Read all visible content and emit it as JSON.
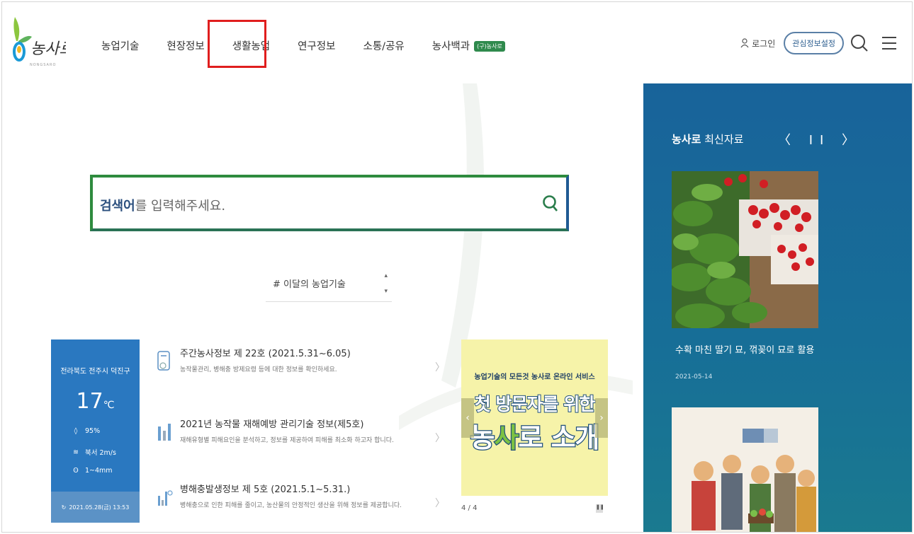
{
  "header": {
    "logo_text": "농사로",
    "nav": [
      {
        "label": "농업기술"
      },
      {
        "label": "현장정보"
      },
      {
        "label": "생활농업"
      },
      {
        "label": "연구정보"
      },
      {
        "label": "소통/공유"
      },
      {
        "label": "농사백과"
      }
    ],
    "nav_badge": "(구)농사로",
    "login_label": "로그인",
    "interest_label": "관심정보설정"
  },
  "search": {
    "placeholder_bold": "검색어",
    "placeholder_rest": "를 입력해주세요."
  },
  "topic": {
    "label": "# 이달의 농업기술"
  },
  "weather": {
    "location": "전라북도 전주시 덕진구",
    "temperature": "17",
    "unit": "℃",
    "humidity": "95%",
    "wind": "북서 2m/s",
    "rain": "1~4mm",
    "datetime": "2021.05.28(금) 13:53"
  },
  "news": [
    {
      "title": "주간농사정보 제 22호 (2021.5.31~6.05)",
      "desc": "농작물관리, 병해충 방제요령 등에 대한 정보를 확인하세요."
    },
    {
      "title": "2021년 농작물 재해예방 관리기술 정보(제5호)",
      "desc": "재해유형별 피해요인을 분석하고, 정보를 제공하여 피해를 최소화 하고자 합니다."
    },
    {
      "title": "병해충발생정보 제 5호 (2021.5.1~5.31.)",
      "desc": "병해충으로 인한 피해를 줄이고, 농산물의 안정적인 생산을 위해 정보를 제공합니다."
    }
  ],
  "banner": {
    "subtitle": "농업기술의 모든것 농사로 온라인 서비스",
    "line1": "첫 방문자를 위한",
    "line2_a": "농",
    "line2_b": "사",
    "line2_c": "로 소개",
    "pager": "4 / 4"
  },
  "side": {
    "title_bold": "농사로",
    "title_rest": " 최신자료",
    "controls": "〈 II 〉",
    "caption": "수확 마친 딸기 묘, 꺾꽂이 묘로 활용",
    "date": "2021-05-14"
  },
  "colors": {
    "accent_blue": "#18639a",
    "search_green": "#2e8b3e",
    "active_outline": "#e01e1e"
  }
}
